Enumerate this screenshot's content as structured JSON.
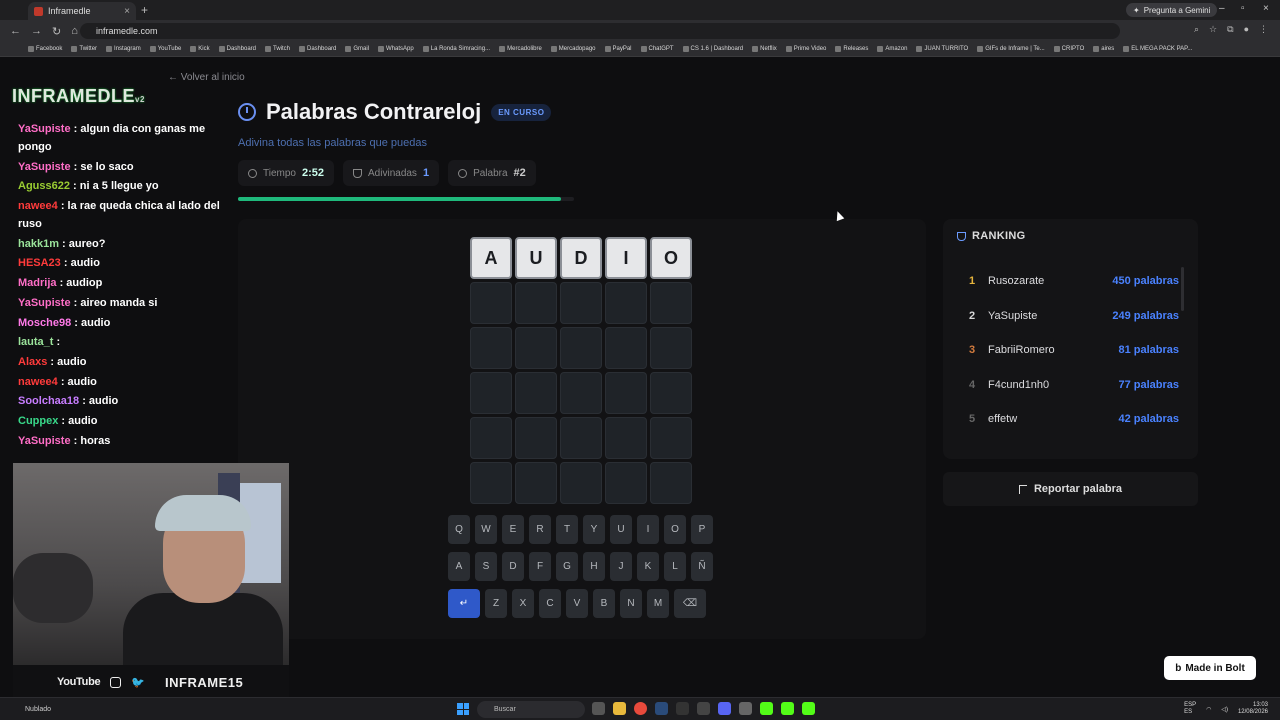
{
  "browser": {
    "tab_title": "Inframedle",
    "url": "inframedle.com",
    "gemini_label": "Pregunta a Gemini",
    "bookmarks": [
      "Facebook",
      "Twitter",
      "Instagram",
      "YouTube",
      "Kick",
      "Dashboard",
      "Twitch",
      "Dashboard",
      "Gmail",
      "WhatsApp",
      "La Ronda Simracing...",
      "Mercadolibre",
      "Mercadopago",
      "PayPal",
      "ChatGPT",
      "CS 1.6 | Dashboard",
      "Netflix",
      "Prime Video",
      "Releases",
      "Amazon",
      "JUAN TURRITO",
      "GIFs de Inframe | Te...",
      "CRIPTO",
      "aires",
      "EL MEGA PACK PAP..."
    ]
  },
  "page": {
    "back_label": "Volver al inicio",
    "title": "Palabras Contrareloj",
    "status_badge": "EN CURSO",
    "subtitle": "Adivina todas las palabras que puedas",
    "stats": {
      "time_label": "Tiempo",
      "time_value": "2:52",
      "guessed_label": "Adivinadas",
      "guessed_value": "1",
      "word_label": "Palabra",
      "word_value": "#2"
    },
    "progress_fraction": 0.96,
    "current_guess": [
      "A",
      "U",
      "D",
      "I",
      "O"
    ],
    "grid_rows": 6,
    "keyboard": {
      "row1": [
        "Q",
        "W",
        "E",
        "R",
        "T",
        "Y",
        "U",
        "I",
        "O",
        "P"
      ],
      "row2": [
        "A",
        "S",
        "D",
        "F",
        "G",
        "H",
        "J",
        "K",
        "L",
        "Ñ"
      ],
      "row3": [
        "Z",
        "X",
        "C",
        "V",
        "B",
        "N",
        "M"
      ],
      "enter_symbol": "↵",
      "backspace_symbol": "⌫"
    },
    "ranking": {
      "title": "RANKING",
      "entries": [
        {
          "pos": "1",
          "name": "Rusozarate",
          "score": "450 palabras"
        },
        {
          "pos": "2",
          "name": "YaSupiste",
          "score": "249 palabras"
        },
        {
          "pos": "3",
          "name": "FabriiRomero",
          "score": "81 palabras"
        },
        {
          "pos": "4",
          "name": "F4cund1nh0",
          "score": "77 palabras"
        },
        {
          "pos": "5",
          "name": "effetw",
          "score": "42 palabras"
        }
      ]
    },
    "report_label": "Reportar palabra",
    "made_in_bolt": "Made in Bolt",
    "accent_color": "#4a82ff",
    "progress_color": "#1fb97c"
  },
  "stream": {
    "logo": "INFRAMEDLE",
    "logo_version": "v2",
    "chat": [
      {
        "user": "YaSupiste",
        "color": "#ff6ec7",
        "text": ": algun dia con ganas me pongo"
      },
      {
        "user": "YaSupiste",
        "color": "#ff6ec7",
        "text": ": se lo saco"
      },
      {
        "user": "Aguss622",
        "color": "#9acd32",
        "text": ": ni a 5 llegue yo"
      },
      {
        "user": "nawee4",
        "color": "#ff3b3b",
        "text": ": la rae queda chica al lado del ruso"
      },
      {
        "user": "hakk1m",
        "color": "#9be39b",
        "text": ": aureo?"
      },
      {
        "user": "HESA23",
        "color": "#ff3b3b",
        "text": ": audio"
      },
      {
        "user": "Madrija",
        "color": "#ff6ec7",
        "text": ": audiop"
      },
      {
        "user": "YaSupiste",
        "color": "#ff6ec7",
        "text": ": aireo manda si"
      },
      {
        "user": "Mosche98",
        "color": "#ff79e8",
        "text": ": audio"
      },
      {
        "user": "lauta_t",
        "color": "#9be39b",
        "text": ":"
      },
      {
        "user": "Alaxs",
        "color": "#ff3b3b",
        "text": ": audio"
      },
      {
        "user": "nawee4",
        "color": "#ff3b3b",
        "text": ": audio"
      },
      {
        "user": "Soolchaa18",
        "color": "#c77dff",
        "text": ": audio"
      },
      {
        "user": "Cuppex",
        "color": "#39d98a",
        "text": ": audio"
      },
      {
        "user": "YaSupiste",
        "color": "#ff6ec7",
        "text": ": horas"
      }
    ],
    "social": {
      "youtube": "YouTube",
      "handle": "INFRAME15"
    }
  },
  "taskbar": {
    "weather": "Nublado",
    "search": "Buscar",
    "lang": "ESP\nES",
    "time": "13:03",
    "date": "12/08/2026"
  }
}
